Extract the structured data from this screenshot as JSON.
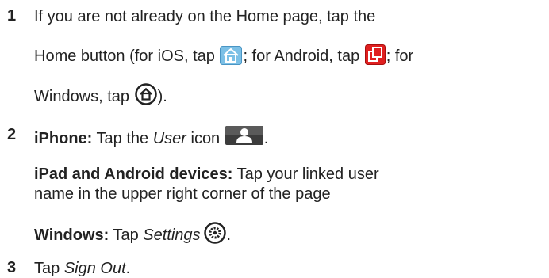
{
  "steps": [
    {
      "number": "1",
      "line1": "If you are not already on the Home page, tap the",
      "line2_pre": "Home button (for iOS, tap ",
      "line2_mid": "; for Android, tap ",
      "line2_post": "; for",
      "line3_pre": "Windows, tap ",
      "line3_post": ").",
      "icons": [
        "home-icon-ios",
        "home-icon-android",
        "home-icon-windows"
      ]
    },
    {
      "number": "2",
      "iphone_label": "iPhone:",
      "iphone_text_pre": " Tap the ",
      "iphone_italic": "User",
      "iphone_text_post": " icon ",
      "iphone_end": ".",
      "ipad_label": "iPad and Android devices:",
      "ipad_text1": " Tap your linked user",
      "ipad_text2": "name in the upper right corner of the page",
      "windows_label": "Windows:",
      "windows_text_pre": " Tap ",
      "windows_italic": "Settings",
      "windows_end": ".",
      "icons": [
        "user-icon",
        "settings-icon"
      ]
    },
    {
      "number": "3",
      "text_pre": "Tap ",
      "italic": "Sign Out",
      "text_post": "."
    }
  ],
  "colors": {
    "text": "#222222",
    "ios_icon": "#6fb7e0",
    "android_icon": "#d91a1a",
    "user_icon_bg": "#3a3a3a"
  }
}
